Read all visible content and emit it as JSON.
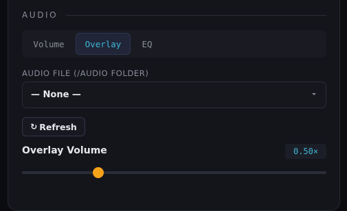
{
  "section": {
    "title": "AUDIO"
  },
  "tabs": [
    {
      "label": "Volume",
      "active": false
    },
    {
      "label": "Overlay",
      "active": true
    },
    {
      "label": "EQ",
      "active": false
    }
  ],
  "audio_file": {
    "label": "AUDIO FILE (/AUDIO FOLDER)",
    "selected": "— None —"
  },
  "refresh_button": {
    "icon": "refresh-icon",
    "label": "Refresh"
  },
  "overlay_volume": {
    "label": "Overlay Volume",
    "display": "0.50×",
    "value": 0.5,
    "min": 0,
    "max": 2
  },
  "colors": {
    "accent_cyan": "#3fb6d6",
    "slider_thumb": "#f5a21b"
  }
}
